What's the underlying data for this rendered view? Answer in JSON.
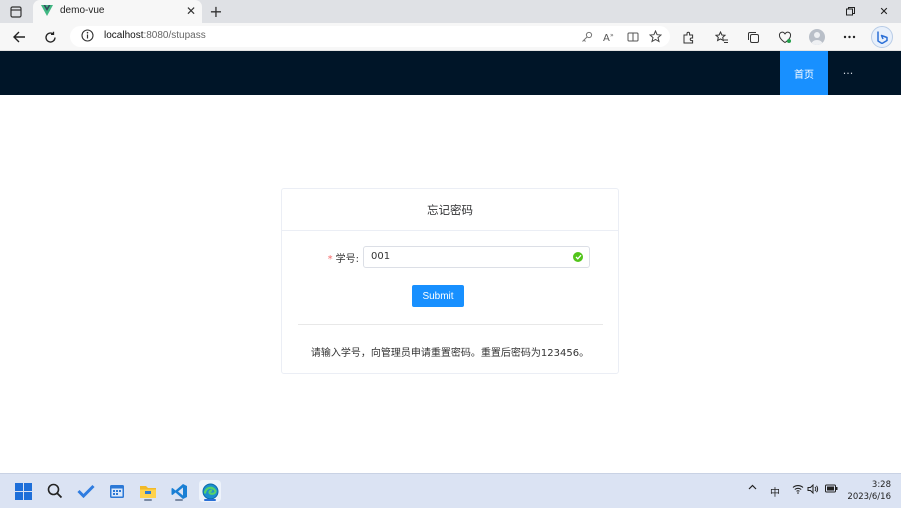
{
  "browser": {
    "tab_title": "demo-vue",
    "url_host": "localhost",
    "url_path": ":8080/stupass"
  },
  "app": {
    "nav": {
      "home_label": "首页",
      "more_label": "···"
    },
    "card": {
      "title": "忘记密码",
      "student_id_label": "学号:",
      "student_id_value": "001",
      "submit_label": "Submit",
      "hint": "请输入学号，向管理员申请重置密码。重置后密码为123456。"
    },
    "colors": {
      "header_bg": "#001528",
      "primary": "#1890ff",
      "success": "#52c41a",
      "required": "#f56c6c"
    }
  },
  "taskbar": {
    "ime": "中",
    "time": "3:28",
    "date": "2023/6/16"
  }
}
